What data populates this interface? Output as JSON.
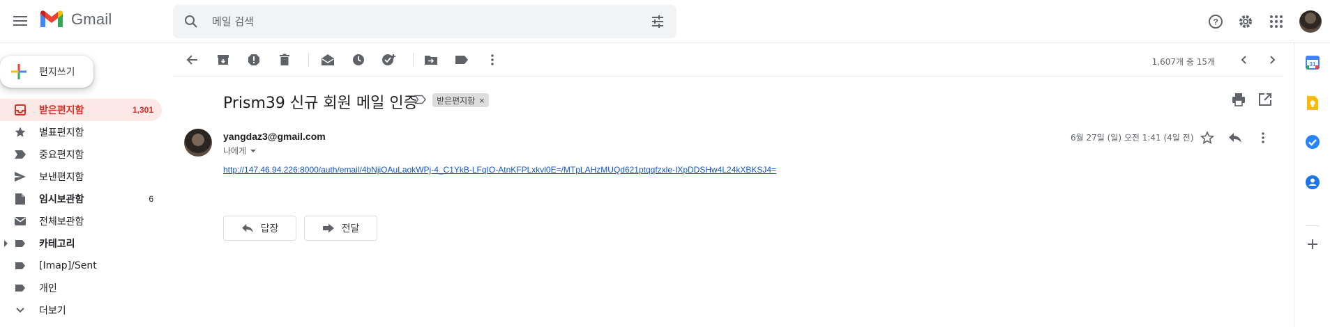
{
  "app": {
    "name": "Gmail"
  },
  "search": {
    "placeholder": "메일 검색"
  },
  "compose": {
    "label": "편지쓰기"
  },
  "nav": {
    "items": [
      {
        "label": "받은편지함",
        "count": "1,301",
        "active": true
      },
      {
        "label": "별표편지함",
        "count": ""
      },
      {
        "label": "중요편지함",
        "count": ""
      },
      {
        "label": "보낸편지함",
        "count": ""
      },
      {
        "label": "임시보관함",
        "count": "6"
      },
      {
        "label": "전체보관함",
        "count": ""
      },
      {
        "label": "카테고리",
        "count": ""
      },
      {
        "label": "[Imap]/Sent",
        "count": ""
      },
      {
        "label": "개인",
        "count": ""
      },
      {
        "label": "더보기",
        "count": ""
      }
    ]
  },
  "toolbar": {
    "page_count": "1,607개 중 15개"
  },
  "email": {
    "subject": "Prism39 신규 회원 메일 인증",
    "label_chip": "받은편지함",
    "label_chip_close": "×",
    "sender": "yangdaz3@gmail.com",
    "to": "나에게",
    "date": "6월 27일 (일) 오전 1:41 (4일 전)",
    "link": "http://147.46.94.226:8000/auth/email/4bNjiOAuLaokWPj-4_C1YkB-LFqIO-AtnKFPLxkvl0E=/MTpLAHzMUQd621ptqqfzxle-IXpDDSHw4L24kXBKSJ4="
  },
  "actions": {
    "reply": "답장",
    "forward": "전달"
  },
  "colors": {
    "accent_red": "#d93025",
    "active_bg": "#fce8e6",
    "link": "#1155cc"
  }
}
